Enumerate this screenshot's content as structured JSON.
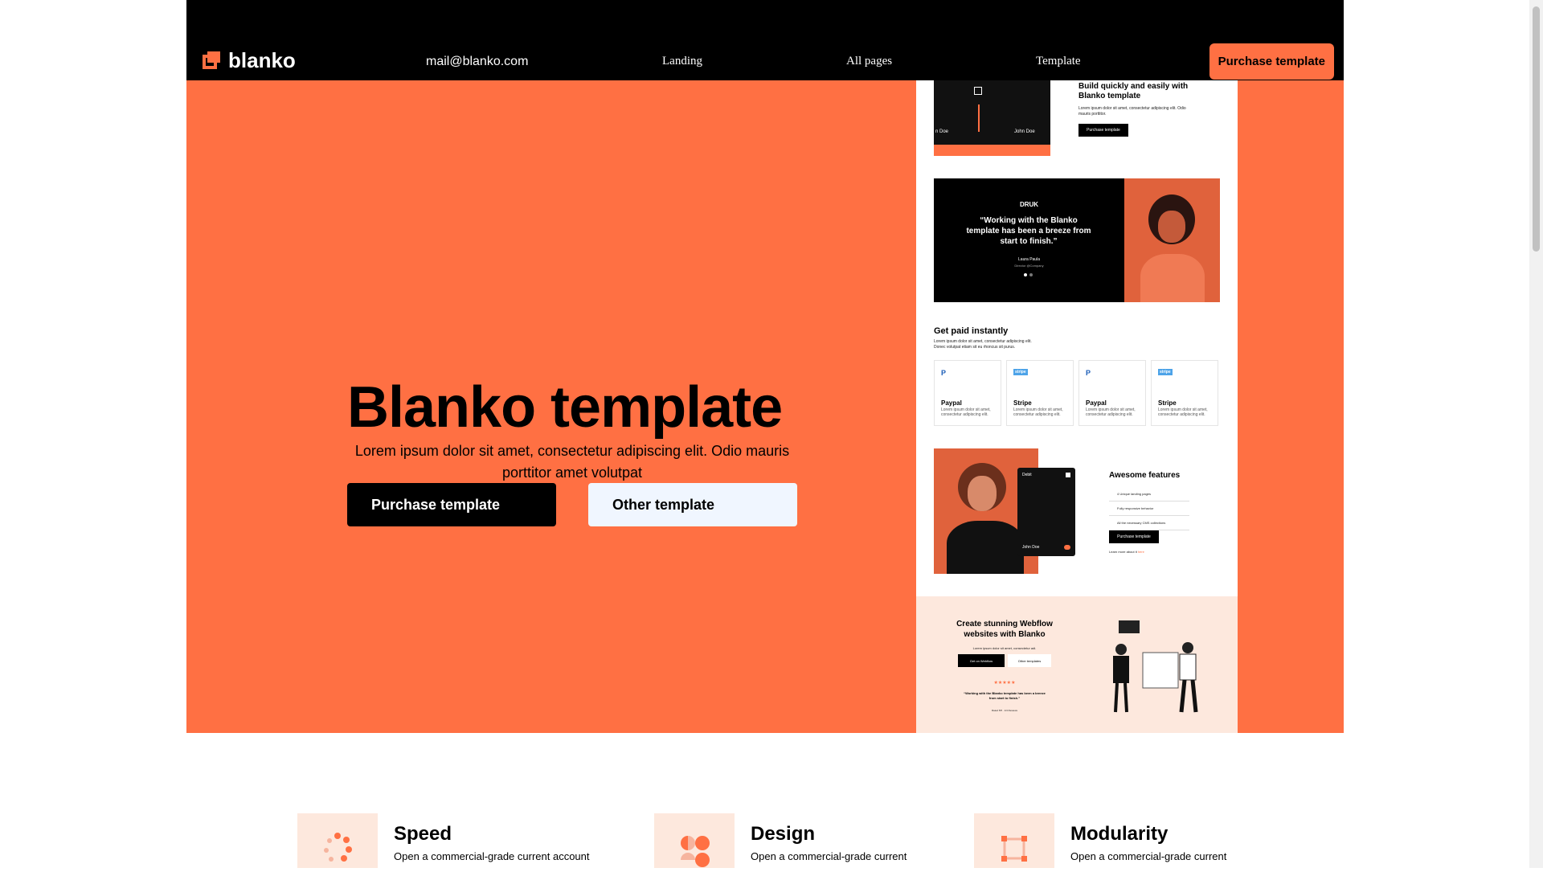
{
  "header": {
    "logo_text": "blanko",
    "email": "mail@blanko.com",
    "nav": [
      "Landing",
      "All pages",
      "Template"
    ],
    "purchase_label": "Purchase template"
  },
  "hero": {
    "title": "Blanko template",
    "subtitle": "Lorem ipsum dolor sit amet, consectetur adipiscing elit. Odio mauris porttitor amet volutpat",
    "primary_cta": "Purchase template",
    "secondary_cta": "Other template"
  },
  "preview": {
    "block1": {
      "heading": "Build quickly and easily with Blanko template",
      "text": "Lorem ipsum dolor sit amet, consectetur adipiscing elit. Odio mauris porttitor.",
      "button": "Purchase template",
      "name_left": "n Doe",
      "name_right": "John Doe"
    },
    "testimonial": {
      "brand": "DRUK",
      "quote": "“Working with the Blanko template has been a breeze from start to finish.”",
      "author": "Laura Paula",
      "role": "Director @Company"
    },
    "payments": {
      "heading": "Get paid instantly",
      "text": "Lorem ipsum dolor sit amet, consectetur adipiscing elit. Donec volutpat etiam sit eu rhoncus sit purus.",
      "cards": [
        {
          "name": "Paypal",
          "icon": "P",
          "desc": "Lorem ipsum dolor sit amet, consectetur adipiscing elit."
        },
        {
          "name": "Stripe",
          "icon": "stripe",
          "desc": "Lorem ipsum dolor sit amet, consectetur adipiscing elit."
        },
        {
          "name": "Paypal",
          "icon": "P",
          "desc": "Lorem ipsum dolor sit amet, consectetur adipiscing elit."
        },
        {
          "name": "Stripe",
          "icon": "stripe",
          "desc": "Lorem ipsum dolor sit amet, consectetur adipiscing elit."
        }
      ]
    },
    "features": {
      "heading": "Awesome features",
      "items": [
        "4 Unique landing pages",
        "Fully responsive behavior",
        "All the necessary CMS collections"
      ],
      "button": "Purchase template",
      "learn_more": "Learn more about it",
      "learn_link": "here",
      "card_label": "Debit",
      "card_name": "John Doe"
    },
    "footer_cta": {
      "heading": "Create stunning Webflow websites with Blanko",
      "text": "Lorem ipsum dolor sit amet, consectetur adi.",
      "btn1": "Get on Webflow",
      "btn2": "Other templates",
      "stars": "★★★★★",
      "quote": "“Working with the Blanko template has been a breeze from start to finish.”",
      "rating": "Rated 5/5 · 1/4 Reviews"
    }
  },
  "features": [
    {
      "title": "Speed",
      "desc": "Open a commercial-grade current account",
      "icon": "speed-dots-icon"
    },
    {
      "title": "Design",
      "desc": "Open a commercial-grade current",
      "icon": "design-shapes-icon"
    },
    {
      "title": "Modularity",
      "desc": "Open a commercial-grade current",
      "icon": "modularity-grid-icon"
    }
  ],
  "colors": {
    "accent": "#ff7043",
    "dark": "#000000",
    "light_accent": "#fde8dd"
  }
}
